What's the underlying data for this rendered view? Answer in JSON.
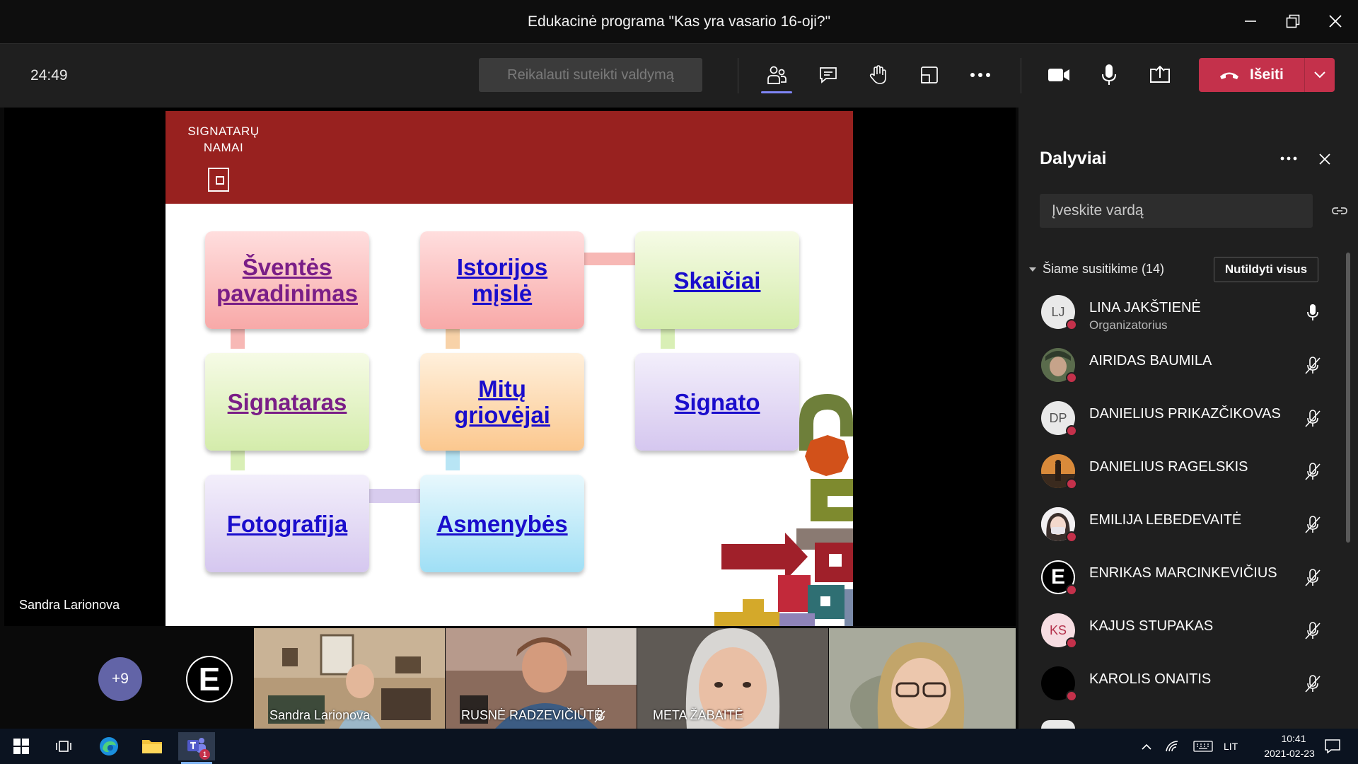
{
  "window": {
    "title": "Edukacinė programa \"Kas yra vasario 16-oji?\""
  },
  "toolbar": {
    "timer": "24:49",
    "request_control_label": "Reikalauti suteikti valdymą",
    "leave_label": "Išeiti"
  },
  "stage": {
    "presenter_name": "Sandra Larionova",
    "slide": {
      "logo_line1": "SIGNATARŲ",
      "logo_line2": "NAMAI",
      "tiles": [
        {
          "label": "Šventės pavadinimas",
          "visited": true
        },
        {
          "label": "Istorijos mįslė",
          "visited": false
        },
        {
          "label": "Skaičiai",
          "visited": false
        },
        {
          "label": "Signataras",
          "visited": true
        },
        {
          "label": "Mitų griovėjai",
          "visited": false
        },
        {
          "label": "Signato",
          "visited": false
        },
        {
          "label": "Fotografija",
          "visited": false
        },
        {
          "label": "Asmenybės",
          "visited": false
        }
      ]
    }
  },
  "thumbnails": {
    "more_count": "+9",
    "letter_avatar": "E",
    "videos": [
      {
        "label": "Sandra Larionova"
      },
      {
        "label": "RUSNĖ RADZEVIČIŪTĖ"
      },
      {
        "label": "META ŽABAITĖ"
      },
      {
        "label": ""
      }
    ]
  },
  "panel": {
    "title": "Dalyviai",
    "search_placeholder": "Įveskite vardą",
    "section_label": "Šiame susitikime (14)",
    "mute_all_label": "Nutildyti visus",
    "participants": [
      {
        "name": "LINA JAKŠTIENĖ",
        "role": "Organizatorius",
        "initials": "LJ",
        "mic": "on"
      },
      {
        "name": "AIRIDAS BAUMILA",
        "initials": "",
        "mic": "off"
      },
      {
        "name": "DANIELIUS PRIKAZČIKOVAS",
        "initials": "DP",
        "mic": "off"
      },
      {
        "name": "DANIELIUS RAGELSKIS",
        "initials": "",
        "mic": "off"
      },
      {
        "name": "EMILIJA LEBEDEVAITĖ",
        "initials": "",
        "mic": "off"
      },
      {
        "name": "ENRIKAS MARCINKEVIČIUS",
        "initials": "E",
        "mic": "off"
      },
      {
        "name": "KAJUS STUPAKAS",
        "initials": "KS",
        "mic": "off"
      },
      {
        "name": "KAROLIS ONAITIS",
        "initials": "",
        "mic": "off"
      }
    ]
  },
  "taskbar": {
    "teams_badge": "1",
    "language": "LIT",
    "time": "10:41",
    "date": "2021-02-23"
  },
  "colors": {
    "accent": "#6264a7",
    "leave": "#c4314b",
    "slide_header": "#98211f",
    "link": "#1a0dcc",
    "link_visited": "#7a1e87"
  }
}
